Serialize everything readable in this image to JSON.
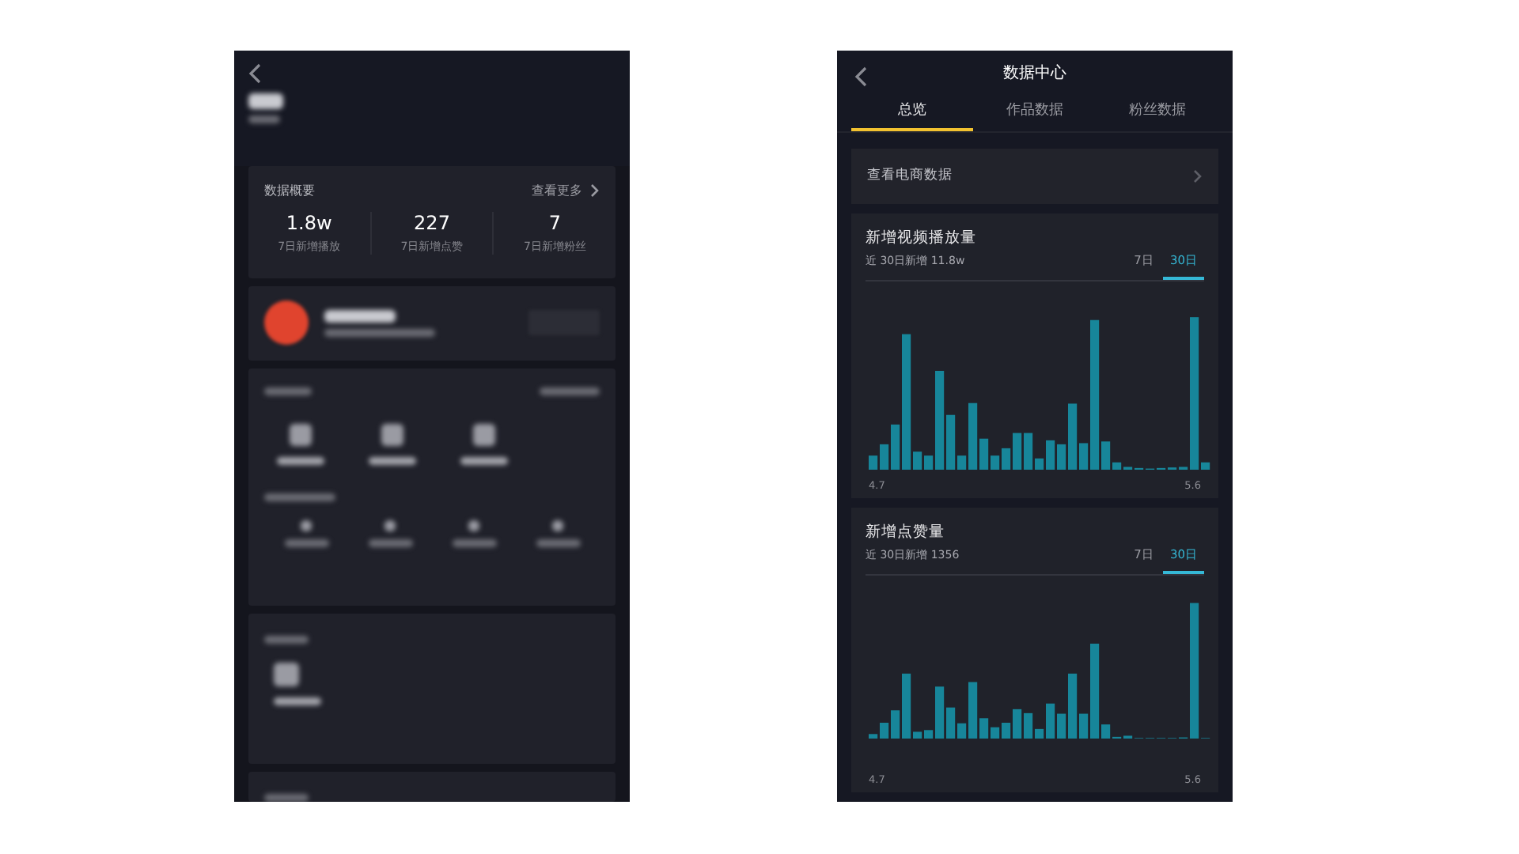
{
  "profile_screen": {
    "overview": {
      "title": "数据概要",
      "more_link": "查看更多",
      "stats": [
        {
          "value": "1.8w",
          "label": "7日新增播放"
        },
        {
          "value": "227",
          "label": "7日新增点赞"
        },
        {
          "value": "7",
          "label": "7日新增粉丝"
        }
      ]
    }
  },
  "data_center": {
    "title": "数据中心",
    "tabs": [
      {
        "label": "总览",
        "selected": true
      },
      {
        "label": "作品数据",
        "selected": false
      },
      {
        "label": "粉丝数据",
        "selected": false
      }
    ],
    "ecommerce_link": "查看电商数据",
    "cards": [
      {
        "title": "新增视频播放量",
        "subtitle": "近 30日新增 11.8w",
        "ranges": [
          {
            "label": "7日",
            "selected": false
          },
          {
            "label": "30日",
            "selected": true
          }
        ],
        "x_start": "4.7",
        "x_end": "5.6"
      },
      {
        "title": "新增点赞量",
        "subtitle": "近 30日新增 1356",
        "ranges": [
          {
            "label": "7日",
            "selected": false
          },
          {
            "label": "30日",
            "selected": true
          }
        ],
        "x_start": "4.7",
        "x_end": "5.6"
      }
    ]
  }
}
